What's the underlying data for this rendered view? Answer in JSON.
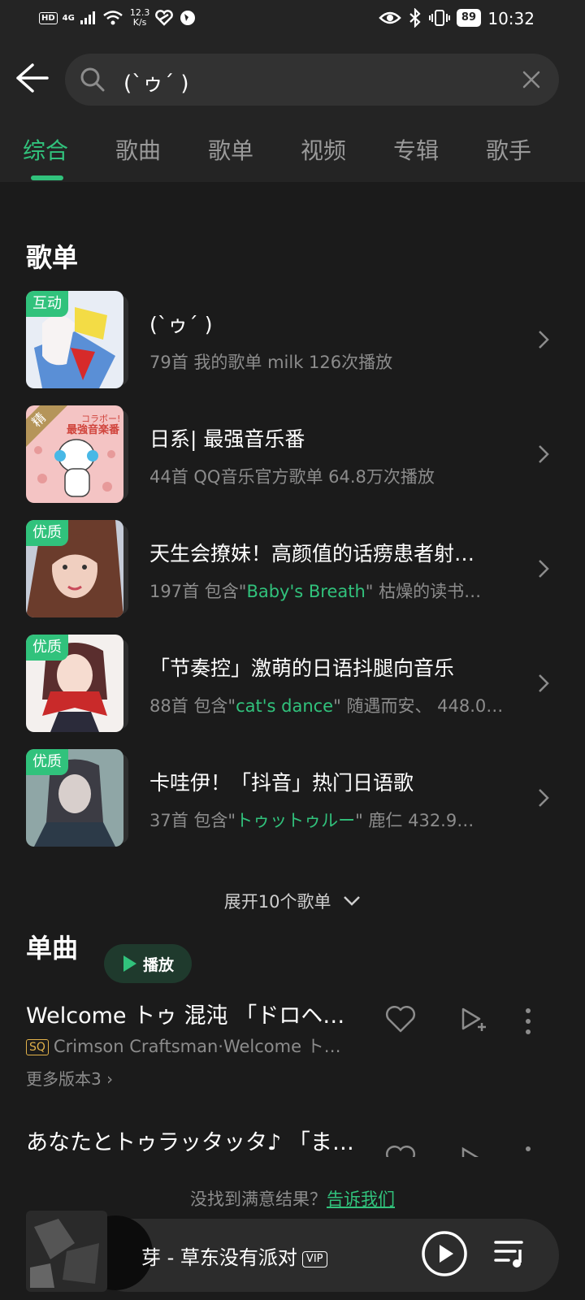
{
  "status_bar": {
    "hd": "HD",
    "network": "4G",
    "speed_value": "12.3",
    "speed_unit": "K/s",
    "battery": "89",
    "time": "10:32"
  },
  "search": {
    "query": "(`ゥ´ )"
  },
  "tabs": [
    "综合",
    "歌曲",
    "歌单",
    "视频",
    "专辑",
    "歌手"
  ],
  "playlists_section": {
    "title": "歌单",
    "items": [
      {
        "badge": "互动",
        "title": "(`ゥ´ )",
        "sub": "79首  我的歌单 milk  126次播放"
      },
      {
        "badge": "精",
        "title": "日系| 最强音乐番",
        "sub": "44首  QQ音乐官方歌单  64.8万次播放"
      },
      {
        "badge": "优质",
        "title": "天生会撩妹！高颜值的话痨患者射…",
        "count": "197首",
        "prefix": "包含\"",
        "highlight": "Baby's Breath",
        "suffix": "\" 枯燥的读书…"
      },
      {
        "badge": "优质",
        "title": "「节奏控」激萌的日语抖腿向音乐",
        "count": "88首",
        "prefix": "包含\"",
        "highlight": "cat's dance",
        "suffix": "\" 随遇而安、  448.0…"
      },
      {
        "badge": "优质",
        "title": "卡哇伊！「抖音」热门日语歌",
        "count": "37首",
        "prefix": "包含\"",
        "highlight": "トゥットゥルー",
        "suffix": "\" 鹿仁  432.9…"
      }
    ],
    "expand_label": "展开10个歌单"
  },
  "songs_section": {
    "title": "单曲",
    "play_label": "播放",
    "items": [
      {
        "title": "Welcome トゥ 混沌 「ドロヘド…",
        "quality": "SQ",
        "sub": "Crimson Craftsman·Welcome ト…",
        "more": "更多版本3"
      },
      {
        "title": "あなたとトゥラッタッタ♪ 「ま…"
      }
    ]
  },
  "feedback": {
    "text": "没找到满意结果？",
    "link": "告诉我们"
  },
  "player": {
    "title": "芽 - 草东没有派对",
    "vip": "VIP"
  },
  "colors": {
    "accent": "#31c27c",
    "background": "#1b1b1b",
    "header": "#242424",
    "secondary_text": "#8c8c8c"
  }
}
